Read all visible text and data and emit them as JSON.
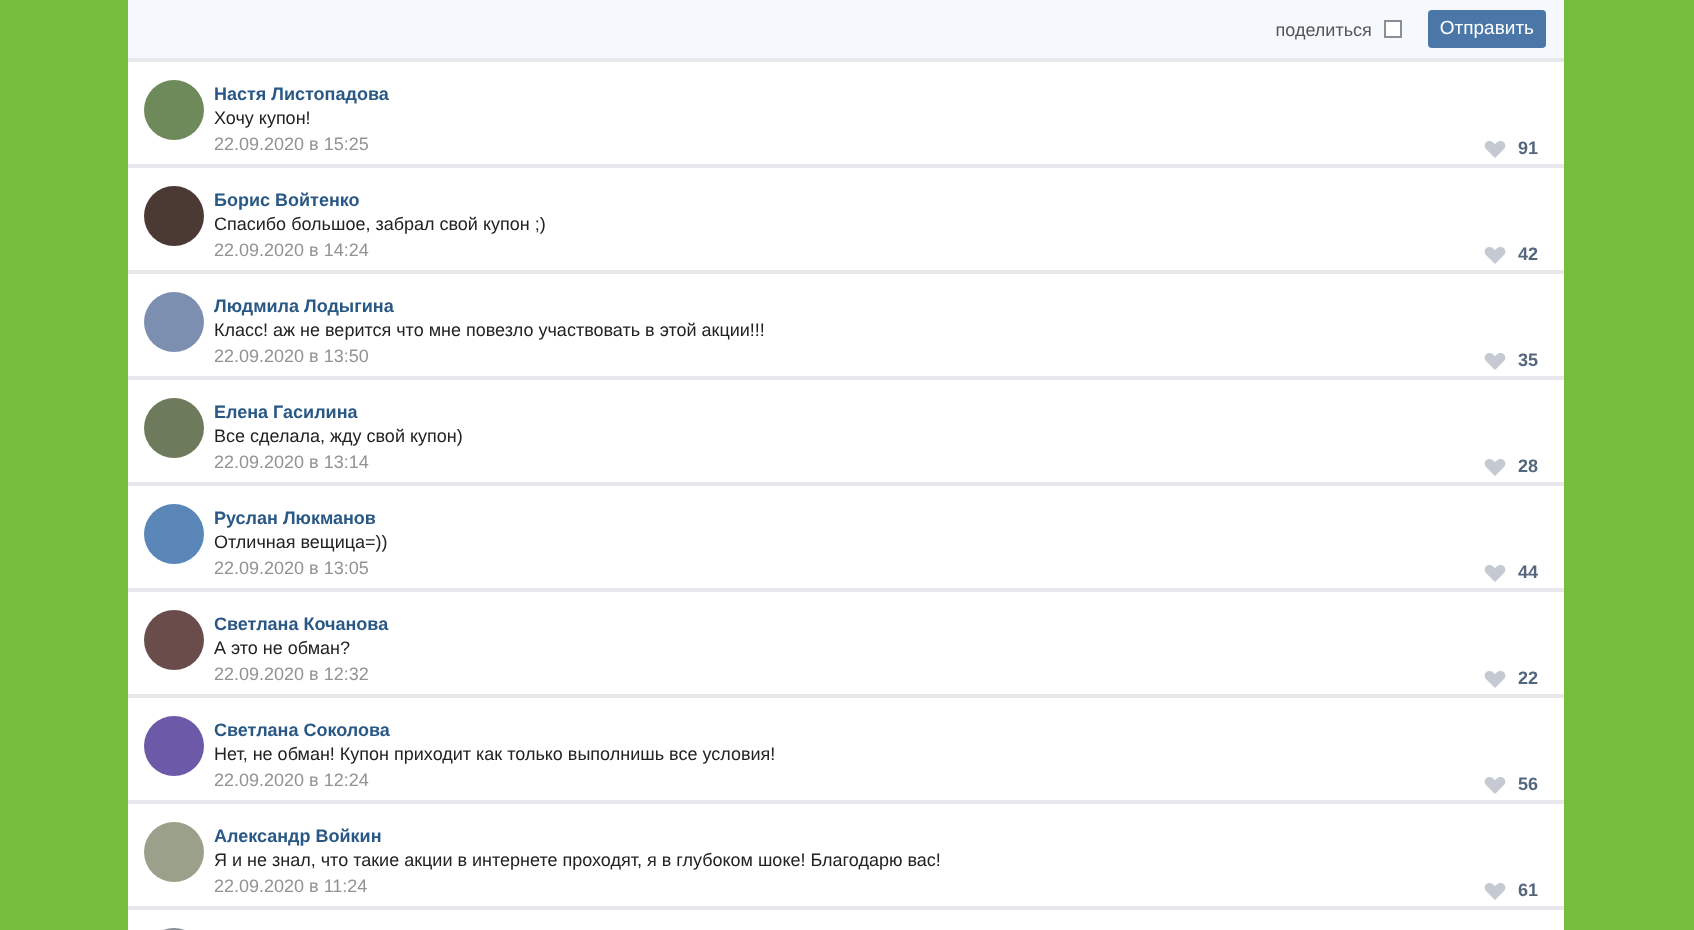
{
  "composer": {
    "share_label": "поделиться",
    "share_checked": false,
    "send_button": "Отправить"
  },
  "comments": [
    {
      "author": "Настя Листопадова",
      "text": "Хочу купон!",
      "date": "22.09.2020 в 15:25",
      "likes": "91"
    },
    {
      "author": "Борис Войтенко",
      "text": "Спасибо большое, забрал свой купон ;)",
      "date": "22.09.2020 в 14:24",
      "likes": "42"
    },
    {
      "author": "Людмила Лодыгина",
      "text": "Класс! аж не верится что мне повезло участвовать в этой акции!!!",
      "date": "22.09.2020 в 13:50",
      "likes": "35"
    },
    {
      "author": "Елена Гасилина",
      "text": "Все сделала, жду свой купон)",
      "date": "22.09.2020 в 13:14",
      "likes": "28"
    },
    {
      "author": "Руслан Люкманов",
      "text": "Отличная вещица=))",
      "date": "22.09.2020 в 13:05",
      "likes": "44"
    },
    {
      "author": "Светлана Кочанова",
      "text": "А это не обман?",
      "date": "22.09.2020 в 12:32",
      "likes": "22"
    },
    {
      "author": "Светлана Соколова",
      "text": "Нет, не обман! Купон приходит как только выполнишь все условия!",
      "date": "22.09.2020 в 12:24",
      "likes": "56"
    },
    {
      "author": "Александр Войкин",
      "text": "Я и не знал, что такие акции в интернете проходят, я в глубоком шоке! Благодарю вас!",
      "date": "22.09.2020 в 11:24",
      "likes": "61"
    }
  ]
}
